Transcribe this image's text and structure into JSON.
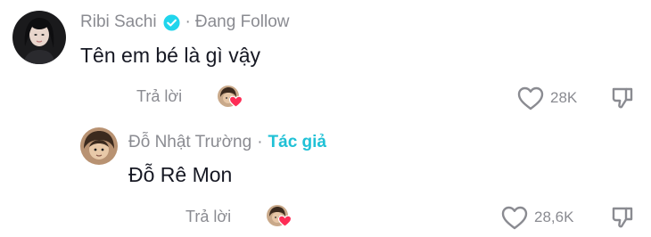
{
  "colors": {
    "author_tag": "#20c1d6",
    "verified": "#20d5ec",
    "muted": "#8a8b91",
    "text": "#161823",
    "heart": "#fe2c55"
  },
  "comments": [
    {
      "username": "Ribi Sachi",
      "verified_icon": "verified-badge-icon",
      "separator": "·",
      "follow_status": "Đang Follow",
      "text": "Tên em bé là gì vậy",
      "reply_label": "Trả lời",
      "like_count": "28K",
      "liked_by_author": true
    },
    {
      "username": "Đỗ Nhật Trường",
      "separator": "·",
      "author_label": "Tác giả",
      "text": "Đỗ Rê Mon",
      "reply_label": "Trả lời",
      "like_count": "28,6K",
      "liked_by_author": true
    }
  ]
}
